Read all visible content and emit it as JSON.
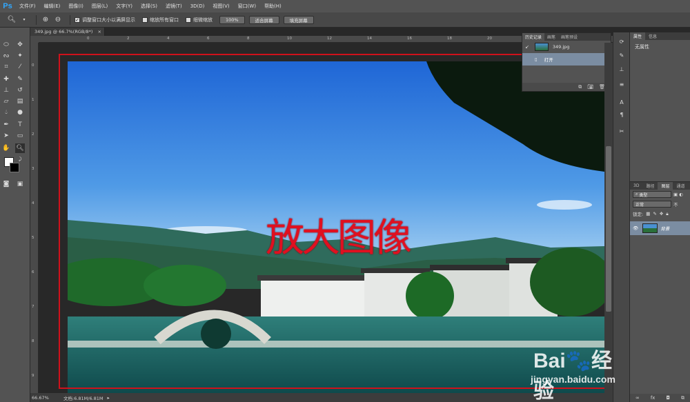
{
  "app": {
    "logo": "Ps"
  },
  "menu": [
    "文件(F)",
    "编辑(E)",
    "图像(I)",
    "图层(L)",
    "文字(Y)",
    "选择(S)",
    "滤镜(T)",
    "3D(D)",
    "视图(V)",
    "窗口(W)",
    "帮助(H)"
  ],
  "options": {
    "checkbox_resize": "调整窗口大小以满屏显示",
    "checkbox_all_windows": "缩放所有窗口",
    "checkbox_scrubby": "细微缩放",
    "btn_100": "100%",
    "btn_fit": "适合屏幕",
    "btn_fill": "填充屏幕"
  },
  "document": {
    "tab_title": "349.jpg @ 66.7%(RGB/8*)",
    "tab_close": "×",
    "zoom_level": "66.67%",
    "doc_size": "文档:6.81M/6.81M"
  },
  "ruler": {
    "top_ticks": [
      "0",
      "2",
      "4",
      "6",
      "8",
      "10",
      "12",
      "14",
      "16",
      "18",
      "20",
      "22",
      "24"
    ],
    "left_ticks": [
      "0",
      "1",
      "2",
      "3",
      "4",
      "5",
      "6",
      "7",
      "8",
      "9"
    ]
  },
  "overlay_text": "放大图像",
  "history": {
    "tabs": [
      "历史记录",
      "画笔",
      "画笔预设"
    ],
    "items": [
      {
        "label": "349.jpg"
      },
      {
        "label": "打开"
      }
    ]
  },
  "properties": {
    "tabs": [
      "属性",
      "信息"
    ],
    "empty": "无属性"
  },
  "layers": {
    "tabs": [
      "3D",
      "路径",
      "图层",
      "通道"
    ],
    "filter": "类型",
    "blend_mode": "正常",
    "opacity_prefix": "不",
    "lock_label": "锁定:",
    "layer_name": "背景"
  },
  "watermark": {
    "logo": "Bai🐾经验",
    "url": "jingyan.baidu.com"
  },
  "colors": {
    "accent_red": "#d0111b",
    "selection_blue": "#7b8da2",
    "ps_blue": "#31a8ff"
  }
}
